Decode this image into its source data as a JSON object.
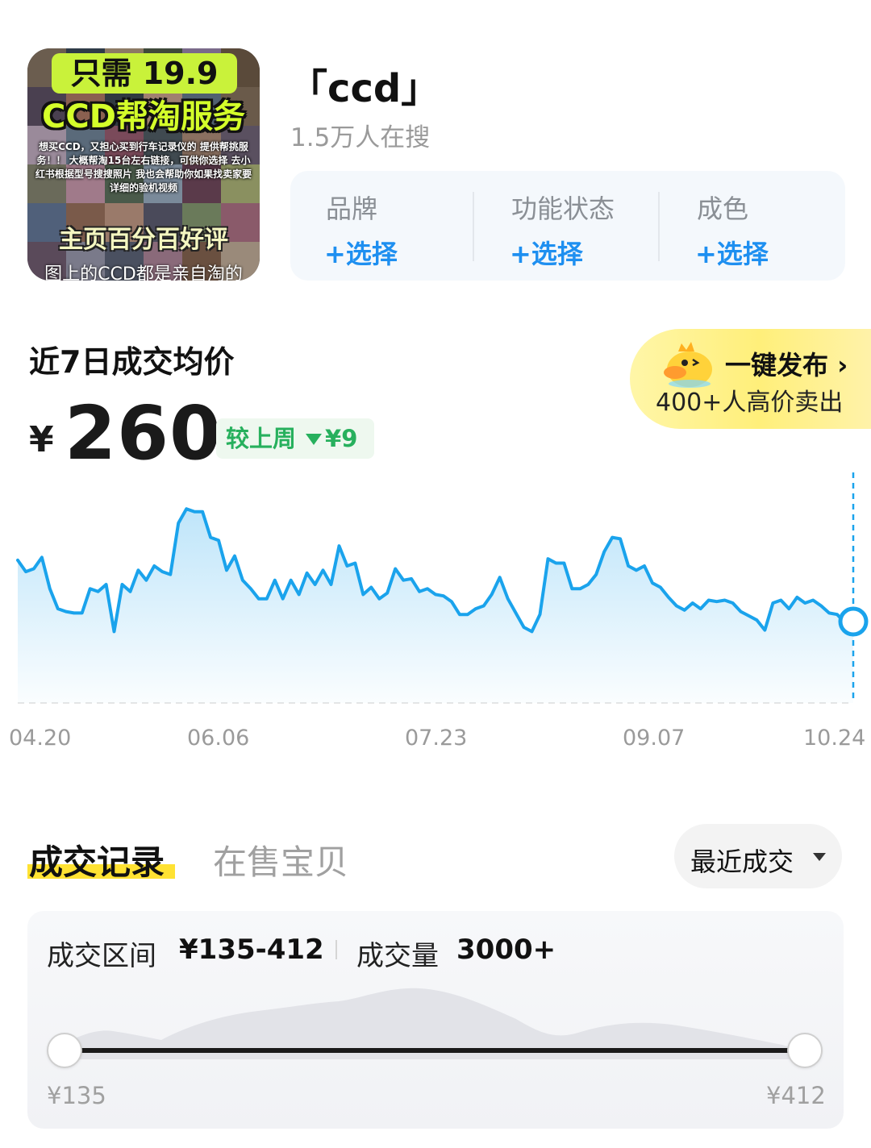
{
  "product": {
    "thumbnail": {
      "line1": "只需 19.9",
      "line2": "CCD帮淘服务",
      "small_text": "想买CCD，又担心买到行车记录仪的 提供帮挑服务！！ 大概帮淘15台左右链接，可供你选择 去小红书根据型号搜搜照片 我也会帮助你如果找卖家要详细的验机视频",
      "line3": "主页百分百好评",
      "line4": "图上的CCD都是亲自淘的"
    },
    "title": "「ccd」",
    "searchers": "1.5万人在搜"
  },
  "filters": [
    {
      "name": "品牌",
      "select_label": "+选择"
    },
    {
      "name": "功能状态",
      "select_label": "+选择"
    },
    {
      "name": "成色",
      "select_label": "+选择"
    }
  ],
  "price_section": {
    "title": "近7日成交均价",
    "currency": "¥",
    "avg_price": "260",
    "delta_label": "较上周",
    "delta_value": "¥9",
    "delta_direction": "down"
  },
  "publish": {
    "title": "一键发布",
    "subtitle": "400+人高价卖出",
    "mascot_icon": "duck-mascot-icon"
  },
  "chart_data": {
    "type": "area",
    "x_ticks": [
      "04.20",
      "06.06",
      "07.23",
      "09.07",
      "10.24"
    ],
    "y_axis_visible": false,
    "series": [
      {
        "values": [
          282,
          274,
          276,
          284,
          262,
          248,
          246,
          245,
          245,
          262,
          260,
          265,
          232,
          265,
          260,
          275,
          268,
          278,
          274,
          272,
          308,
          318,
          316,
          316,
          298,
          296,
          275,
          285,
          268,
          262,
          255,
          255,
          268,
          255,
          268,
          258,
          273,
          265,
          275,
          265,
          292,
          278,
          280,
          258,
          263,
          255,
          259,
          276,
          268,
          269,
          260,
          262,
          258,
          257,
          253,
          244,
          244,
          248,
          250,
          258,
          270,
          255,
          245,
          235,
          232,
          244,
          283,
          280,
          280,
          262,
          262,
          265,
          272,
          288,
          298,
          297,
          278,
          275,
          278,
          266,
          263,
          256,
          250,
          247,
          252,
          248,
          254,
          253,
          254,
          252,
          246,
          243,
          240,
          233,
          252,
          254,
          248,
          256,
          252,
          254,
          250,
          245,
          244,
          238,
          239
        ],
        "color": "#1aa3ec"
      }
    ],
    "highlight_last_point": true
  },
  "records": {
    "tab_active": "成交记录",
    "tab_inactive": "在售宝贝",
    "sort_label": "最近成交",
    "range_label": "成交区间",
    "range_value": "¥135-412",
    "volume_label": "成交量",
    "volume_value": "3000+",
    "min_label": "¥135",
    "max_label": "¥412"
  }
}
